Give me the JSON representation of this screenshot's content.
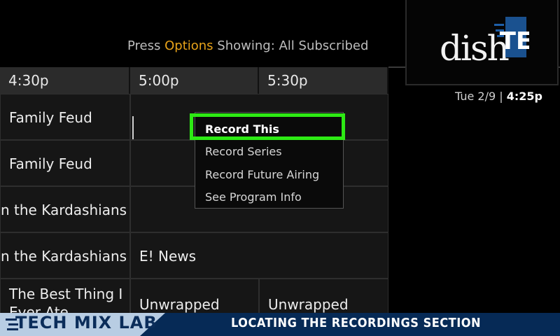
{
  "hint": {
    "press": "Press",
    "options": "Options",
    "showing": "Showing: All Subscribed"
  },
  "logo": {
    "dish": "dish",
    "te": "TE"
  },
  "datetime": {
    "date": "Tue 2/9",
    "sep": "|",
    "time": "4:25p"
  },
  "times": [
    "4:30p",
    "5:00p",
    "5:30p"
  ],
  "rows": [
    [
      "Family Feud",
      "",
      ""
    ],
    [
      "Family Feud",
      "",
      ""
    ],
    [
      "n the Kardashians",
      "",
      ""
    ],
    [
      "n the Kardashians",
      "E! News",
      ""
    ],
    [
      "The Best Thing I Ever Ate",
      "Unwrapped",
      "Unwrapped"
    ]
  ],
  "menu": [
    "Record This",
    "Record Series",
    "Record Future Airing",
    "See Program Info"
  ],
  "footer": {
    "brand": "TECH MIX LAB",
    "title": "LOCATING THE RECORDINGS SECTION"
  },
  "colors": {
    "highlight": "#2dea14",
    "options": "#e8a31a",
    "footer_bg": "#062a56"
  }
}
